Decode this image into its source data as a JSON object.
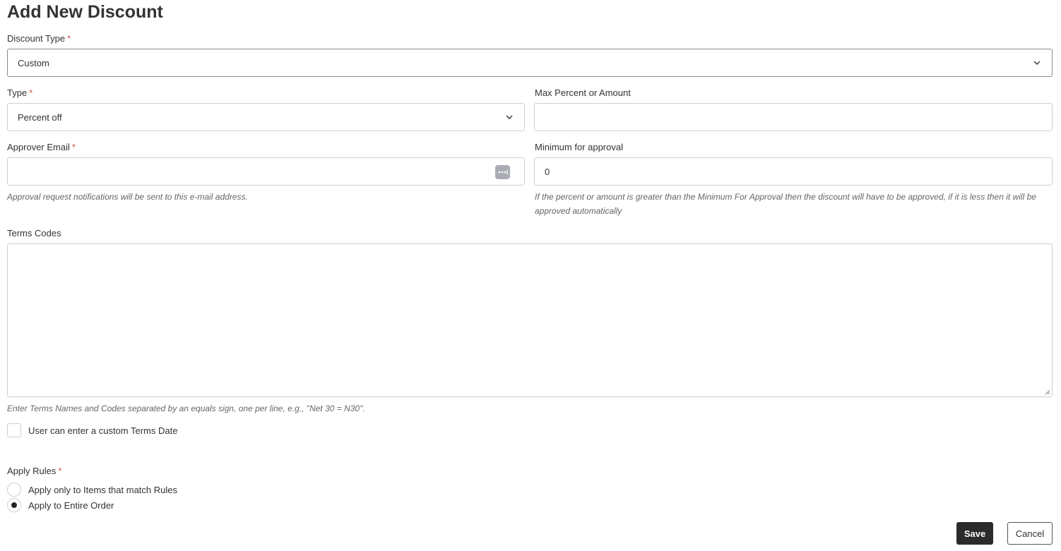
{
  "page": {
    "title": "Add New Discount"
  },
  "form": {
    "discount_type": {
      "label": "Discount Type",
      "required_mark": "*",
      "value": "Custom"
    },
    "type": {
      "label": "Type",
      "required_mark": "*",
      "value": "Percent off"
    },
    "max_amount": {
      "label": "Max Percent or Amount",
      "value": ""
    },
    "approver_email": {
      "label": "Approver Email",
      "required_mark": "*",
      "value": "",
      "help": "Approval request notifications will be sent to this e-mail address."
    },
    "min_approval": {
      "label": "Minimum for approval",
      "value": "0",
      "help": "If the percent or amount is greater than the Minimum For Approval then the discount will have to be approved, if it is less then it will be approved automatically"
    },
    "terms_codes": {
      "label": "Terms Codes",
      "value": "",
      "help": "Enter Terms Names and Codes separated by an equals sign, one per line, e.g., \"Net 30 = N30\"."
    },
    "custom_terms_date": {
      "label": "User can enter a custom Terms Date",
      "checked": false
    },
    "apply_rules": {
      "label": "Apply Rules",
      "required_mark": "*",
      "options": [
        {
          "label": "Apply only to Items that match Rules",
          "selected": false
        },
        {
          "label": "Apply to Entire Order",
          "selected": true
        }
      ]
    }
  },
  "actions": {
    "save_label": "Save",
    "cancel_label": "Cancel"
  },
  "colors": {
    "required": "#d9534f",
    "primary_button": "#2b2b2b",
    "border": "#cfcfcf"
  }
}
